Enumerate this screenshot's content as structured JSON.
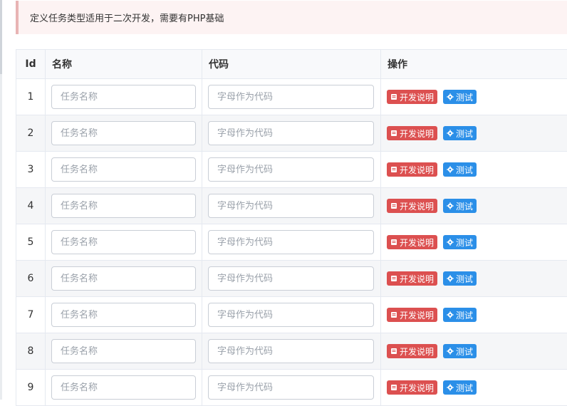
{
  "alert": {
    "text": "定义任务类型适用于二次开发，需要有PHP基础"
  },
  "table": {
    "headers": {
      "id": "Id",
      "name": "名称",
      "code": "代码",
      "ops": "操作"
    },
    "rows": [
      {
        "id": "1",
        "name_placeholder": "任务名称",
        "code_placeholder": "字母作为代码",
        "dev_label": "开发说明",
        "test_label": "测试"
      },
      {
        "id": "2",
        "name_placeholder": "任务名称",
        "code_placeholder": "字母作为代码",
        "dev_label": "开发说明",
        "test_label": "测试"
      },
      {
        "id": "3",
        "name_placeholder": "任务名称",
        "code_placeholder": "字母作为代码",
        "dev_label": "开发说明",
        "test_label": "测试"
      },
      {
        "id": "4",
        "name_placeholder": "任务名称",
        "code_placeholder": "字母作为代码",
        "dev_label": "开发说明",
        "test_label": "测试"
      },
      {
        "id": "5",
        "name_placeholder": "任务名称",
        "code_placeholder": "字母作为代码",
        "dev_label": "开发说明",
        "test_label": "测试"
      },
      {
        "id": "6",
        "name_placeholder": "任务名称",
        "code_placeholder": "字母作为代码",
        "dev_label": "开发说明",
        "test_label": "测试"
      },
      {
        "id": "7",
        "name_placeholder": "任务名称",
        "code_placeholder": "字母作为代码",
        "dev_label": "开发说明",
        "test_label": "测试"
      },
      {
        "id": "8",
        "name_placeholder": "任务名称",
        "code_placeholder": "字母作为代码",
        "dev_label": "开发说明",
        "test_label": "测试"
      },
      {
        "id": "9",
        "name_placeholder": "任务名称",
        "code_placeholder": "字母作为代码",
        "dev_label": "开发说明",
        "test_label": "测试"
      }
    ]
  },
  "icons": {
    "dev": "book-icon",
    "test": "gear-icon"
  },
  "colors": {
    "alert_bg": "#fdf3f3",
    "alert_border": "#e8b4b4",
    "dev_button": "#dc5050",
    "test_button": "#2b8fe8",
    "alt_row": "#f5f6f8"
  }
}
